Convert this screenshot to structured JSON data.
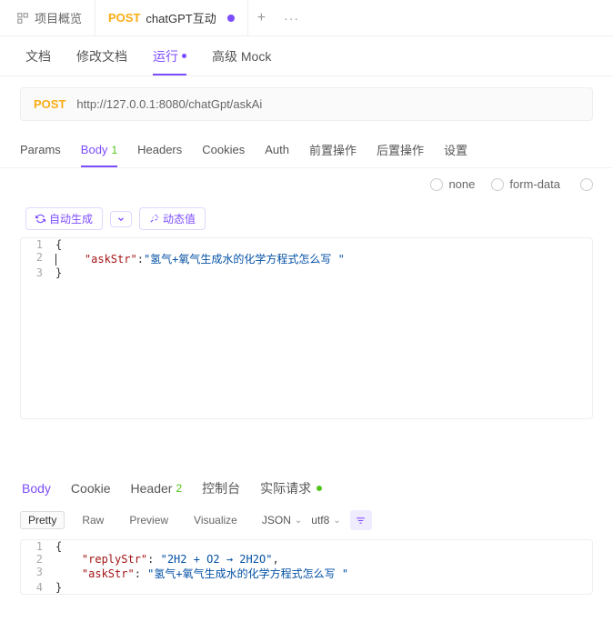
{
  "topTabs": {
    "overview": "项目概览",
    "active": {
      "method": "POST",
      "name": "chatGPT互动"
    }
  },
  "subNav": {
    "doc": "文档",
    "editDoc": "修改文档",
    "run": "运行",
    "mock": "高级 Mock"
  },
  "urlBar": {
    "method": "POST",
    "url": "http://127.0.0.1:8080/chatGpt/askAi"
  },
  "reqTabs": {
    "params": "Params",
    "body": "Body",
    "bodyBadge": "1",
    "headers": "Headers",
    "cookies": "Cookies",
    "auth": "Auth",
    "preAction": "前置操作",
    "postAction": "后置操作",
    "settings": "设置"
  },
  "bodyTypes": {
    "none": "none",
    "formData": "form-data"
  },
  "editorTools": {
    "autoGen": "自动生成",
    "dynamic": "动态值"
  },
  "requestBody": {
    "line1": "{",
    "line2_key": "\"askStr\"",
    "line2_sep": ":",
    "line2_val": "\"氢气+氧气生成水的化学方程式怎么写 \"",
    "line3": "}"
  },
  "responseTabs": {
    "body": "Body",
    "cookie": "Cookie",
    "header": "Header",
    "headerBadge": "2",
    "console": "控制台",
    "actual": "实际请求"
  },
  "respControls": {
    "pretty": "Pretty",
    "raw": "Raw",
    "preview": "Preview",
    "visualize": "Visualize",
    "format": "JSON",
    "encoding": "utf8"
  },
  "responseBody": {
    "line1": "{",
    "line2_key": "\"replyStr\"",
    "line2_sep": ": ",
    "line2_val": "\"2H2 + O2 → 2H2O\"",
    "line2_comma": ",",
    "line3_key": "\"askStr\"",
    "line3_sep": ": ",
    "line3_val": "\"氢气+氧气生成水的化学方程式怎么写 \"",
    "line4": "}"
  }
}
